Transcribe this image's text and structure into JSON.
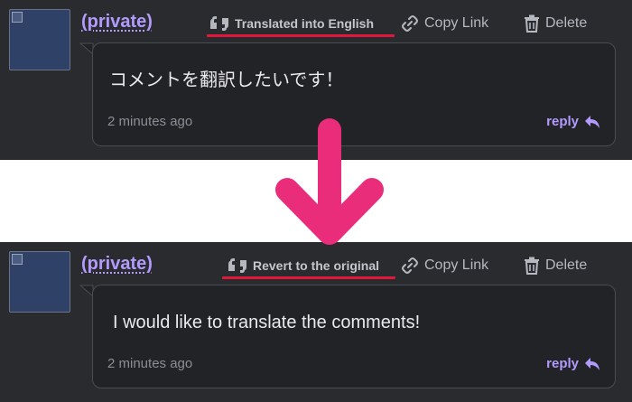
{
  "top_comment": {
    "username": "(private)",
    "translate_action": "Translated into English",
    "copy_link": "Copy Link",
    "delete": "Delete",
    "text": "コメントを翻訳したいです！",
    "timestamp": "2 minutes ago",
    "reply": "reply"
  },
  "bottom_comment": {
    "username": "(private)",
    "translate_action": "Revert to the original",
    "copy_link": "Copy Link",
    "delete": "Delete",
    "text": "I would like to translate the comments!",
    "timestamp": "2 minutes ago",
    "reply": "reply"
  },
  "icons": {
    "translate": "translate-icon",
    "link": "link-icon",
    "trash": "trash-icon",
    "reply": "reply-arrow-icon",
    "transition": "down-arrow-icon"
  },
  "colors": {
    "panel_bg": "#2a2b2f",
    "bubble_bg": "#222327",
    "accent_purple": "#b39afd",
    "highlight_red": "#e0183c",
    "arrow_pink": "#ea2d7b"
  }
}
